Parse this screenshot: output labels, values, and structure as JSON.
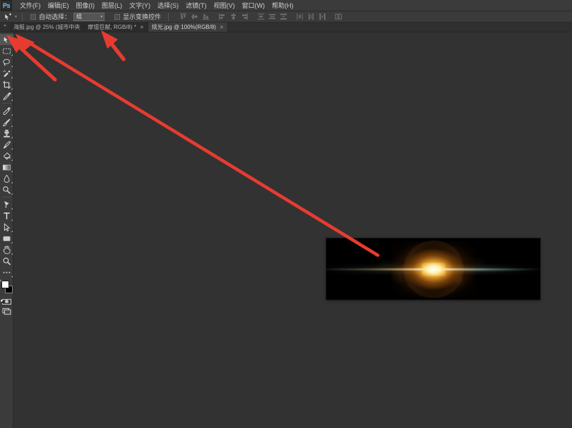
{
  "app": {
    "name": "Adobe Photoshop",
    "logo_text": "Ps",
    "bg_color": "#323232",
    "panel_color": "#3b3b3b",
    "accent_color": "#7fbde4",
    "annotation_color": "#e83b30"
  },
  "menubar": {
    "items": [
      {
        "label": "文件(F)",
        "name": "menu-file"
      },
      {
        "label": "编辑(E)",
        "name": "menu-edit"
      },
      {
        "label": "图像(I)",
        "name": "menu-image"
      },
      {
        "label": "图层(L)",
        "name": "menu-layer"
      },
      {
        "label": "文字(Y)",
        "name": "menu-type"
      },
      {
        "label": "选择(S)",
        "name": "menu-select"
      },
      {
        "label": "滤镜(T)",
        "name": "menu-filter"
      },
      {
        "label": "视图(V)",
        "name": "menu-view"
      },
      {
        "label": "窗口(W)",
        "name": "menu-window"
      },
      {
        "label": "帮助(H)",
        "name": "menu-help"
      }
    ]
  },
  "options_bar": {
    "active_tool_icon": "move-tool-icon",
    "auto_select_label": "自动选择：",
    "auto_select_checked": false,
    "auto_select_value": "组",
    "show_transform_label": "显示变换控件",
    "show_transform_checked": false,
    "align_buttons": [
      "align-top-edges",
      "align-vertical-centers",
      "align-bottom-edges",
      "align-left-edges",
      "align-horizontal-centers",
      "align-right-edges",
      "distribute-top-edges",
      "distribute-vertical-centers",
      "distribute-bottom-edges",
      "distribute-left-edges",
      "distribute-horizontal-centers",
      "distribute-right-edges",
      "auto-align-layers"
    ]
  },
  "tabs": [
    {
      "title": "海报.jpg @ 25% (城市中央",
      "active": false,
      "closeable": true,
      "name": "tab-poster"
    },
    {
      "title": "摩锟巨献, RGB/8) *",
      "active": false,
      "closeable": true,
      "name": "tab-poster-cont"
    },
    {
      "title": "炫光.jpg @ 100%(RGB/8)",
      "active": true,
      "closeable": true,
      "name": "tab-flare"
    }
  ],
  "toolbar": {
    "tools": [
      {
        "name": "move-tool",
        "icon": "move-icon",
        "selected": true,
        "has_flyout": true
      },
      {
        "name": "rectangular-marquee-tool",
        "icon": "marquee-icon",
        "selected": false,
        "has_flyout": true
      },
      {
        "name": "lasso-tool",
        "icon": "lasso-icon",
        "selected": false,
        "has_flyout": true
      },
      {
        "name": "quick-selection-tool",
        "icon": "quick-select-icon",
        "selected": false,
        "has_flyout": true
      },
      {
        "name": "crop-tool",
        "icon": "crop-icon",
        "selected": false,
        "has_flyout": true
      },
      {
        "name": "eyedropper-tool",
        "icon": "eyedropper-icon",
        "selected": false,
        "has_flyout": true
      },
      {
        "name": "spot-healing-brush-tool",
        "icon": "healing-brush-icon",
        "selected": false,
        "has_flyout": true
      },
      {
        "name": "brush-tool",
        "icon": "brush-icon",
        "selected": false,
        "has_flyout": true
      },
      {
        "name": "clone-stamp-tool",
        "icon": "clone-stamp-icon",
        "selected": false,
        "has_flyout": true
      },
      {
        "name": "history-brush-tool",
        "icon": "history-brush-icon",
        "selected": false,
        "has_flyout": true
      },
      {
        "name": "eraser-tool",
        "icon": "eraser-icon",
        "selected": false,
        "has_flyout": true
      },
      {
        "name": "gradient-tool",
        "icon": "gradient-icon",
        "selected": false,
        "has_flyout": true
      },
      {
        "name": "blur-tool",
        "icon": "blur-drop-icon",
        "selected": false,
        "has_flyout": true
      },
      {
        "name": "dodge-tool",
        "icon": "dodge-icon",
        "selected": false,
        "has_flyout": true
      },
      {
        "name": "pen-tool",
        "icon": "pen-icon",
        "selected": false,
        "has_flyout": true
      },
      {
        "name": "horizontal-type-tool",
        "icon": "type-t-icon",
        "selected": false,
        "has_flyout": true
      },
      {
        "name": "path-selection-tool",
        "icon": "path-arrow-icon",
        "selected": false,
        "has_flyout": true
      },
      {
        "name": "rectangle-tool",
        "icon": "rectangle-shape-icon",
        "selected": false,
        "has_flyout": true
      },
      {
        "name": "hand-tool",
        "icon": "hand-icon",
        "selected": false,
        "has_flyout": true
      },
      {
        "name": "zoom-tool",
        "icon": "magnifier-icon",
        "selected": false,
        "has_flyout": false
      },
      {
        "name": "edit-toolbar-tool",
        "icon": "ellipsis-icon",
        "selected": false,
        "has_flyout": true
      }
    ],
    "foreground_color": "#ffffff",
    "background_color": "#000000",
    "quick_mask": "quick-mask-icon",
    "screen_mode": "screen-mode-icon"
  },
  "document": {
    "name": "炫光.jpg",
    "zoom": "100%",
    "mode": "RGB/8",
    "content_description": "lens flare",
    "background": "#000000",
    "flare_core_color": "#fff8d6",
    "flare_mid_color": "#ffb234",
    "flare_streak_color": "#fff8e1",
    "flare_teal_color": "#5aaaa5"
  },
  "annotations": [
    {
      "name": "arrow-to-move-tool",
      "color": "#e83b30",
      "target": "move-tool"
    },
    {
      "name": "arrow-to-document-tab",
      "color": "#e83b30",
      "target": "tab-poster-cont"
    },
    {
      "name": "arrow-tab-to-canvas",
      "color": "#e83b30",
      "target": "tab-flare"
    }
  ]
}
